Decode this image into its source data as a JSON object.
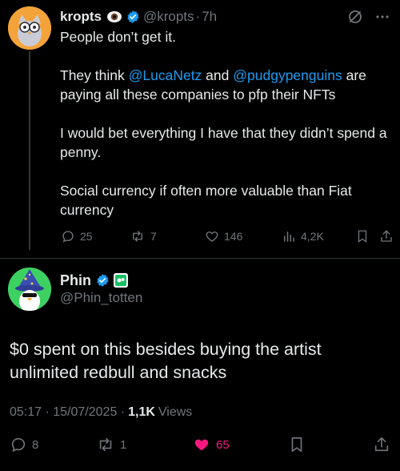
{
  "quoted_post": {
    "author_name": "kropts",
    "handle": "@kropts",
    "separator": "·",
    "time": "7h",
    "paragraphs": {
      "p1": "People don’t get it.",
      "p2_before": "They think ",
      "p2_mention1": "@LucaNetz",
      "p2_mid": " and ",
      "p2_mention2": "@pudgypenguins",
      "p2_after": " are paying all these companies to pfp their NFTs",
      "p3": "I would bet everything I have that they didn’t spend a penny.",
      "p4": "Social currency if often more valuable than Fiat currency"
    },
    "actions": {
      "replies": "25",
      "reposts": "7",
      "likes": "146",
      "views": "4,2K"
    },
    "icons": [
      "eye-emoji-icon",
      "verified-badge-icon",
      "grok-icon",
      "more-icon",
      "reply-icon",
      "repost-icon",
      "like-icon",
      "views-icon",
      "bookmark-icon",
      "share-icon"
    ]
  },
  "reply_post": {
    "author_name": "Phin",
    "handle": "@Phin_totten",
    "text": "$0 spent on this besides buying the artist unlimited redbull and snacks",
    "timestamp": "05:17 · 15/07/2025 · ",
    "views_count": "1,1K",
    "views_label": " Views",
    "actions": {
      "replies": "8",
      "reposts": "1",
      "likes": "65"
    }
  },
  "colors": {
    "background": "#000000",
    "text": "#e7e9ea",
    "muted": "#71767b",
    "link": "#1d9bf0",
    "like": "#f91880",
    "verified": "#1d9bf0",
    "bot_badge": "#17bf63"
  }
}
